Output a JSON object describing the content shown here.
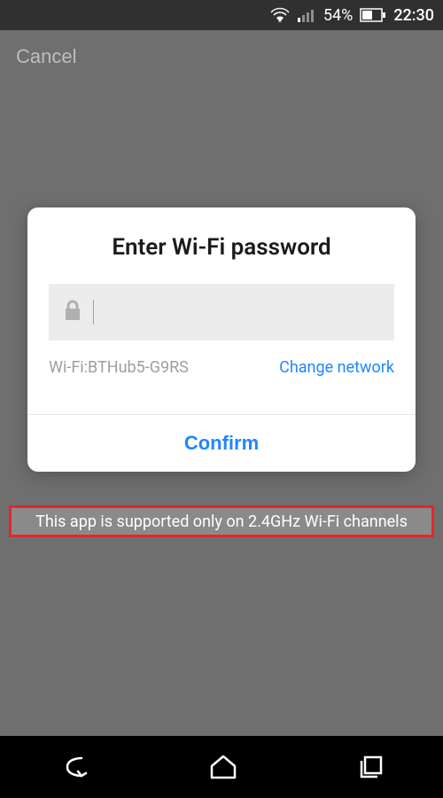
{
  "statusbar": {
    "battery_percent": "54%",
    "time": "22:30"
  },
  "page": {
    "cancel_label": "Cancel"
  },
  "dialog": {
    "title": "Enter Wi-Fi password",
    "password_value": "",
    "wifi_prefix": "Wi-Fi:",
    "wifi_ssid": "BTHub5-G9RS",
    "change_network_label": "Change network",
    "confirm_label": "Confirm"
  },
  "note": {
    "text": "This app is supported only on 2.4GHz Wi-Fi channels"
  }
}
